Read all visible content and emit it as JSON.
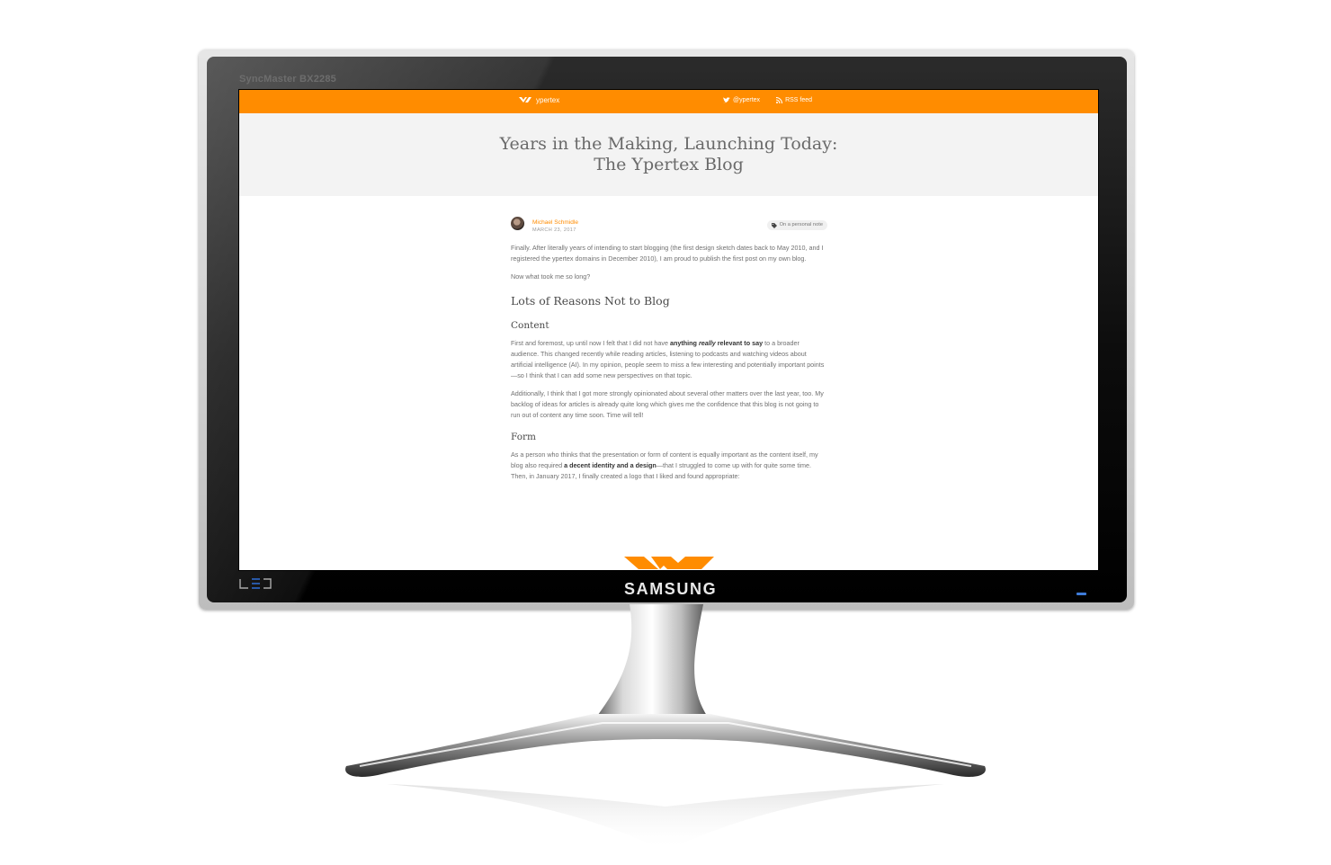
{
  "device": {
    "model": "SyncMaster BX2285",
    "brand": "SAMSUNG",
    "led": "LED"
  },
  "site": {
    "nav": {
      "logo_text": "ypertex",
      "twitter": "@ypertex",
      "rss": "RSS feed"
    },
    "title_line1": "Years in the Making, Launching Today:",
    "title_line2": "The Ypertex Blog",
    "author": "Michael Schmidle",
    "date": "MARCH 23, 2017",
    "tag": "On a personal note",
    "p1": "Finally. After literally years of intending to start blogging (the first design sketch dates back to May 2010, and I registered the ypertex domains in December 2010), I am proud to publish the first post on my own blog.",
    "p2": "Now what took me so long?",
    "h2": "Lots of Reasons Not to Blog",
    "h3_content": "Content",
    "p3_a": "First and foremost, up until now I felt that I did not have ",
    "p3_b1": "anything ",
    "p3_em": "really",
    "p3_b2": " relevant to say",
    "p3_c": " to a broader audience. This changed recently while reading articles, listening to podcasts and watching videos about artificial intelligence (AI). In my opinion, people seem to miss a few interesting and potentially important points—so I think that I can add some new perspectives on that topic.",
    "p4": "Additionally, I think that I got more strongly opinionated about several other matters over the last year, too. My backlog of ideas for articles is already quite long which gives me the confidence that this blog is not going to run out of content any time soon. Time will tell!",
    "h3_form": "Form",
    "p5_a": "As a person who thinks that the presentation or form of content is equally important as the content itself, my blog also required ",
    "p5_b": "a decent identity and a design",
    "p5_c": "—that I struggled to come up with for quite some time. Then, in January 2017, I finally created a logo that I liked and found appropriate:"
  },
  "colors": {
    "accent": "#ff8c00",
    "hero_bg": "#f3f3f3"
  },
  "icons": [
    "ypertex-logo-icon",
    "twitter-icon",
    "rss-icon",
    "tag-icon"
  ]
}
